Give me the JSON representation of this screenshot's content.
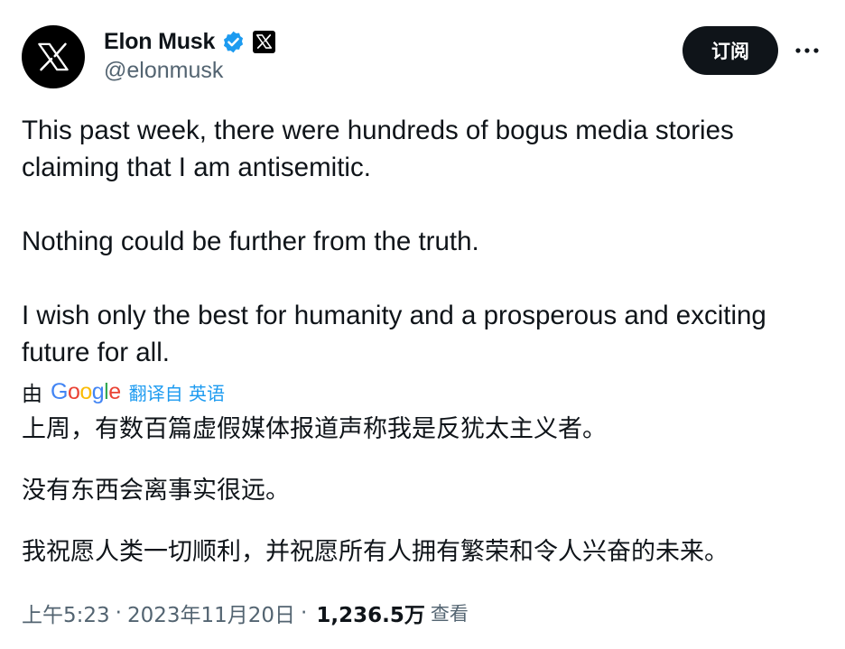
{
  "author": {
    "display_name": "Elon Musk",
    "handle": "@elonmusk",
    "avatar_icon": "x-logo-icon",
    "verified_icon": "verified-badge-icon",
    "verified_color": "#1d9bf0",
    "affiliation_icon": "x-affiliation-badge-icon"
  },
  "actions": {
    "subscribe_label": "订阅",
    "more_icon": "more-options-icon"
  },
  "tweet": {
    "paragraphs": [
      "This past week, there were hundreds of bogus media stories claiming that I am antisemitic.",
      "Nothing could be further from the truth.",
      "I wish only the best for humanity and a prosperous and exciting future for all."
    ]
  },
  "translation": {
    "by_label": "由",
    "provider": "Google",
    "translated_from_label": "翻译自 英语",
    "paragraphs": [
      "上周，有数百篇虚假媒体报道声称我是反犹太主义者。",
      "没有东西会离事实很远。",
      "我祝愿人类一切顺利，并祝愿所有人拥有繁荣和令人兴奋的未来。"
    ]
  },
  "meta": {
    "time": "上午5:23",
    "separator": "·",
    "date": "2023年11月20日",
    "views_count": "1,236.5万",
    "views_label": "查看"
  },
  "colors": {
    "text_primary": "#0f1419",
    "text_secondary": "#536471",
    "link_blue": "#1d9bf0",
    "button_bg": "#0f1419"
  }
}
